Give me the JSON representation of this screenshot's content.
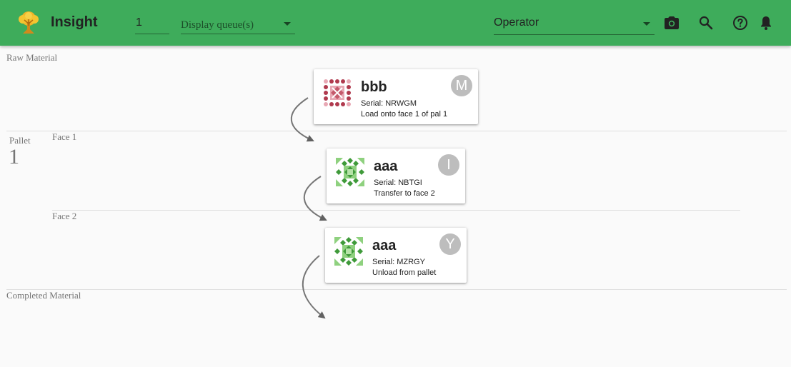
{
  "app": {
    "title": "Insight"
  },
  "toolbar": {
    "pallet_value": "1",
    "queue_placeholder": "Display queue(s)",
    "operator_value": "Operator",
    "icons": [
      "camera-icon",
      "search-icon",
      "help-icon",
      "bell-icon"
    ]
  },
  "sections": {
    "raw_material": "Raw Material",
    "pallet_label": "Pallet",
    "pallet_number": "1",
    "face1": "Face 1",
    "face2": "Face 2",
    "completed": "Completed Material"
  },
  "cards": [
    {
      "part": "bbb",
      "serial": "Serial: NRWGM",
      "action": "Load onto face 1 of pal 1",
      "avatar": "M"
    },
    {
      "part": "aaa",
      "serial": "Serial: NBTGI",
      "action": "Transfer to face 2",
      "avatar": "I"
    },
    {
      "part": "aaa",
      "serial": "Serial: MZRGY",
      "action": "Unload from pallet",
      "avatar": "Y"
    }
  ],
  "colors": {
    "appbar": "#3eac5b",
    "bbb_icon": "#b03a4e",
    "aaa_icon": "#3f9a3a"
  }
}
